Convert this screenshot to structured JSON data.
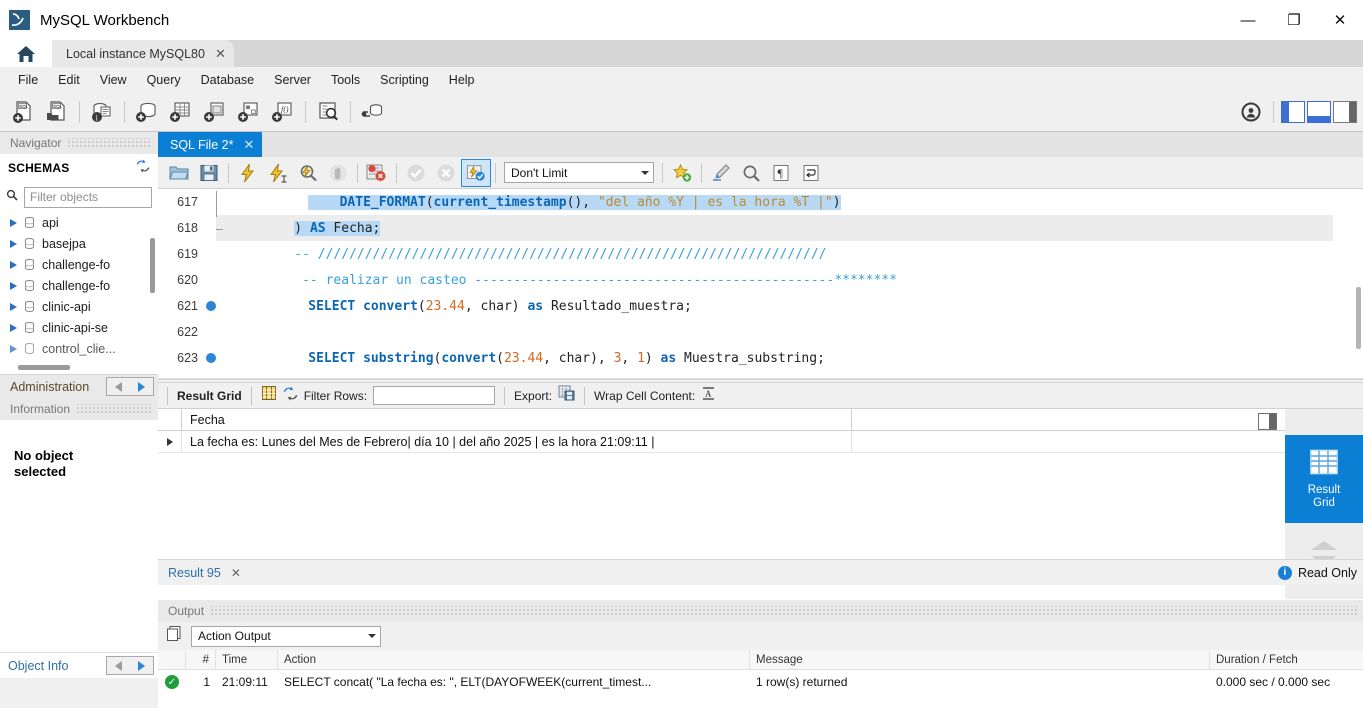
{
  "window": {
    "title": "MySQL Workbench",
    "logo_icon": "mysql-dolphin-icon",
    "minimize_glyph": "—",
    "restore_glyph": "❐",
    "close_glyph": "✕"
  },
  "connection_tabs": {
    "home_icon": "home-icon",
    "tabs": [
      {
        "label": "Local instance MySQL80",
        "close_glyph": "✕"
      }
    ]
  },
  "menubar": {
    "items": [
      "File",
      "Edit",
      "View",
      "Query",
      "Database",
      "Server",
      "Tools",
      "Scripting",
      "Help"
    ]
  },
  "main_toolbar": {
    "buttons": [
      {
        "name": "new-sql-tab-icon",
        "title": "New SQL Tab"
      },
      {
        "name": "open-sql-script-icon",
        "title": "Open SQL Script"
      },
      {
        "name": "connection-info-icon",
        "title": "Connection Info"
      },
      {
        "name": "create-schema-icon",
        "title": "Create Schema"
      },
      {
        "name": "create-table-icon",
        "title": "Create Table"
      },
      {
        "name": "create-view-icon",
        "title": "Create View"
      },
      {
        "name": "create-procedure-icon",
        "title": "Create Procedure"
      },
      {
        "name": "create-function-icon",
        "title": "Create Function"
      },
      {
        "name": "search-data-icon",
        "title": "Search Data"
      },
      {
        "name": "reconnect-server-icon",
        "title": "Reconnect to Server"
      }
    ],
    "right_buttons": [
      {
        "name": "toggle-secondary-sidebar-icon"
      },
      {
        "name": "toggle-sidebar-panel-icon"
      },
      {
        "name": "toggle-output-panel-icon"
      },
      {
        "name": "toggle-secondary-panel-icon"
      }
    ]
  },
  "sidebar": {
    "navigator_title": "Navigator",
    "schemas_title": "SCHEMAS",
    "refresh_icon": "refresh-icon",
    "filter_placeholder": "Filter objects",
    "search_icon": "search-icon",
    "schemas": [
      "api",
      "basejpa",
      "challenge-fo",
      "challenge-fo",
      "clinic-api",
      "clinic-api-se",
      "control_clie..."
    ],
    "bottom_tab": "Administration",
    "information_title": "Information",
    "no_object_text": "No object\nselected",
    "object_info_label": "Object Info",
    "arrow_left_icon": "arrow-left-icon",
    "arrow_right_icon": "arrow-right-icon"
  },
  "editor": {
    "tab_label": "SQL File 2*",
    "tab_close_glyph": "✕",
    "toolbar": {
      "buttons": [
        {
          "name": "open-file-icon",
          "title": "Open a script file"
        },
        {
          "name": "save-file-icon",
          "title": "Save script to file"
        },
        {
          "name": "execute-statement-icon",
          "title": "Execute"
        },
        {
          "name": "execute-current-statement-icon",
          "title": "Execute current statement"
        },
        {
          "name": "explain-statement-icon",
          "title": "Explain"
        },
        {
          "name": "stop-execution-icon",
          "title": "Stop"
        },
        {
          "name": "toggle-stop-on-error-icon",
          "title": "Toggle stop on error"
        },
        {
          "name": "commit-icon",
          "title": "Commit"
        },
        {
          "name": "rollback-icon",
          "title": "Rollback"
        },
        {
          "name": "toggle-autocommit-icon",
          "title": "Toggle autocommit"
        }
      ],
      "limit_value": "Don't Limit",
      "right_buttons": [
        {
          "name": "save-snippet-icon",
          "title": "Save snippet"
        },
        {
          "name": "beautify-sql-icon",
          "title": "Beautify query"
        },
        {
          "name": "find-icon",
          "title": "Find"
        },
        {
          "name": "toggle-invisible-chars-icon",
          "title": "Toggle invisible characters"
        },
        {
          "name": "toggle-wrapping-icon",
          "title": "Toggle word wrap"
        }
      ]
    },
    "lines": [
      {
        "number": "617",
        "breakpoint": false,
        "highlighted": false,
        "selected": true,
        "tokens": [
          {
            "t": "    DATE_FORMAT",
            "c": "fn"
          },
          {
            "t": "(",
            "c": "pln"
          },
          {
            "t": "current_timestamp",
            "c": "fn"
          },
          {
            "t": "(), ",
            "c": "pln"
          },
          {
            "t": "\"del año %Y | es la hora %T |\"",
            "c": "str"
          },
          {
            "t": ")",
            "c": "pln"
          }
        ]
      },
      {
        "number": "618",
        "breakpoint": false,
        "highlighted": true,
        "selected": true,
        "tokens": [
          {
            "t": ") ",
            "c": "pln"
          },
          {
            "t": "AS",
            "c": "kw"
          },
          {
            "t": " Fecha;",
            "c": "pln"
          }
        ]
      },
      {
        "number": "619",
        "breakpoint": false,
        "highlighted": false,
        "selected": false,
        "tokens": [
          {
            "t": "-- /////////////////////////////////////////////////////////////////",
            "c": "cmt"
          }
        ]
      },
      {
        "number": "620",
        "breakpoint": false,
        "highlighted": false,
        "selected": false,
        "tokens": [
          {
            "t": " -- realizar un casteo ----------------------------------------------********",
            "c": "cmt"
          }
        ]
      },
      {
        "number": "621",
        "breakpoint": true,
        "highlighted": false,
        "selected": false,
        "tokens": [
          {
            "t": "SELECT",
            "c": "kw"
          },
          {
            "t": " convert",
            "c": "fn"
          },
          {
            "t": "(",
            "c": "pln"
          },
          {
            "t": "23.44",
            "c": "num"
          },
          {
            "t": ", char) ",
            "c": "pln"
          },
          {
            "t": "as",
            "c": "kw"
          },
          {
            "t": " Resultado_muestra;",
            "c": "pln"
          }
        ]
      },
      {
        "number": "622",
        "breakpoint": false,
        "highlighted": false,
        "selected": false,
        "tokens": []
      },
      {
        "number": "623",
        "breakpoint": true,
        "highlighted": false,
        "selected": false,
        "tokens": [
          {
            "t": "SELECT",
            "c": "kw"
          },
          {
            "t": " substring",
            "c": "fn"
          },
          {
            "t": "(",
            "c": "pln"
          },
          {
            "t": "convert",
            "c": "fn"
          },
          {
            "t": "(",
            "c": "pln"
          },
          {
            "t": "23.44",
            "c": "num"
          },
          {
            "t": ", char), ",
            "c": "pln"
          },
          {
            "t": "3",
            "c": "num"
          },
          {
            "t": ", ",
            "c": "pln"
          },
          {
            "t": "1",
            "c": "num"
          },
          {
            "t": ") ",
            "c": "pln"
          },
          {
            "t": "as",
            "c": "kw"
          },
          {
            "t": " Muestra_substring;",
            "c": "pln"
          }
        ]
      }
    ]
  },
  "result_panel": {
    "toolbar": {
      "title": "Result Grid",
      "grid-view_icon": "grid-view-icon",
      "refresh_icon": "refresh-icon",
      "filter_rows_label": "Filter Rows:",
      "filter_rows_value": "",
      "export_label": "Export:",
      "export_icon": "export-icon",
      "wrap_label": "Wrap Cell Content:",
      "wrap_icon": "wrap-text-icon"
    },
    "columns": [
      "Fecha"
    ],
    "rows": [
      [
        "La fecha es:  Lunes del Mes de Febrero| día 10 |  del año 2025 | es la hora 21:09:11 |"
      ]
    ],
    "side_strip": {
      "tile_label": "Result\nGrid",
      "tile_icon": "result-grid-icon",
      "tile_color": "#0a7fd4",
      "chevron_up_icon": "chevron-up-icon",
      "chevron_down_icon": "chevron-down-icon",
      "panel_toggle_icon": "panel-toggle-icon"
    },
    "tab_label": "Result 95",
    "tab_close_glyph": "✕",
    "readonly_text": "Read Only",
    "readonly_icon": "info-icon"
  },
  "output_panel": {
    "title": "Output",
    "view_icon": "output-view-icon",
    "selected_view": "Action Output",
    "columns": [
      "#",
      "Time",
      "Action",
      "Message",
      "Duration / Fetch"
    ],
    "rows": [
      {
        "status": "success",
        "status_icon": "success-check-icon",
        "num": "1",
        "time": "21:09:11",
        "action": "SELECT concat(    \"La fecha es:  \",    ELT(DAYOFWEEK(current_timest...",
        "message": "1 row(s) returned",
        "duration": "0.000 sec / 0.000 sec"
      }
    ]
  },
  "colors": {
    "accent": "#0a7fd4",
    "titlebar_bg": "#ffffff",
    "chrome_bg": "#f0f0f0",
    "success": "#1e9e3e",
    "comment": "#3aa0d8",
    "keyword": "#0b66b4",
    "string": "#c08a2e",
    "number": "#d2691e",
    "selection": "#b7d9f5"
  }
}
